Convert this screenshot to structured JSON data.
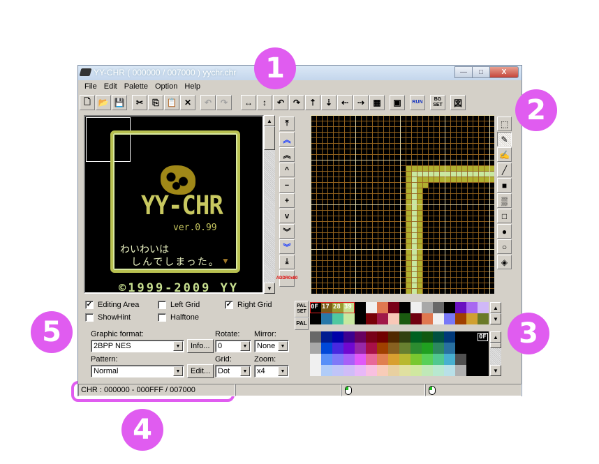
{
  "window": {
    "title": "YY-CHR ( 000000 / 007000 ) yychr.chr",
    "caption_buttons": {
      "minimize": "—",
      "maximize": "□",
      "close": "X"
    }
  },
  "menu": [
    "File",
    "Edit",
    "Palette",
    "Option",
    "Help"
  ],
  "toolbar": {
    "file_buttons": [
      {
        "name": "new-file-icon",
        "glyph": "🗋"
      },
      {
        "name": "open-folder-icon",
        "glyph": "📂"
      },
      {
        "name": "save-icon",
        "glyph": "💾"
      }
    ],
    "edit_buttons": [
      {
        "name": "cut-icon",
        "glyph": "✂"
      },
      {
        "name": "copy-icon",
        "glyph": "⎘"
      },
      {
        "name": "paste-icon",
        "glyph": "📋"
      },
      {
        "name": "delete-icon",
        "glyph": "✕"
      }
    ],
    "history_buttons": [
      {
        "name": "undo-icon",
        "glyph": "↶"
      },
      {
        "name": "redo-icon",
        "glyph": "↷"
      }
    ],
    "transform_buttons": [
      {
        "name": "flip-horizontal-icon",
        "glyph": "↔"
      },
      {
        "name": "flip-vertical-icon",
        "glyph": "↕"
      },
      {
        "name": "rotate-left-icon",
        "glyph": "↶"
      },
      {
        "name": "rotate-right-icon",
        "glyph": "↷"
      },
      {
        "name": "shift-up-icon",
        "glyph": "⇡"
      },
      {
        "name": "shift-down-icon",
        "glyph": "⇣"
      },
      {
        "name": "shift-left-icon",
        "glyph": "⇠"
      },
      {
        "name": "shift-right-icon",
        "glyph": "⇢"
      },
      {
        "name": "replace-color-icon",
        "glyph": "▦"
      }
    ],
    "extra_buttons": [
      {
        "name": "capture-icon",
        "glyph": "▣"
      },
      {
        "name": "run-icon",
        "label": "RUN"
      },
      {
        "name": "bg-set-icon",
        "label": "BG SET"
      },
      {
        "name": "kanji-icon",
        "glyph": "図"
      }
    ]
  },
  "preview": {
    "logo": "YY-CHR",
    "version": "ver.0.99",
    "message_line1": "わいわいは",
    "message_line2": "しんでしまった。",
    "copyright": "©1999-2009 YY"
  },
  "nav_buttons": [
    {
      "name": "scroll-top-icon",
      "glyph": "⤒"
    },
    {
      "name": "page-up-fast-icon",
      "glyph": "︽",
      "blue": true
    },
    {
      "name": "page-up-icon",
      "glyph": "︽"
    },
    {
      "name": "line-up-icon",
      "glyph": "^"
    },
    {
      "name": "minus-icon",
      "glyph": "−"
    },
    {
      "name": "plus-icon",
      "glyph": "+"
    },
    {
      "name": "line-down-icon",
      "glyph": "v"
    },
    {
      "name": "page-down-icon",
      "glyph": "︾"
    },
    {
      "name": "page-down-fast-icon",
      "glyph": "︾",
      "blue": true
    },
    {
      "name": "scroll-bottom-icon",
      "glyph": "⤓"
    }
  ],
  "addr_button": {
    "line1": "ADDR",
    "line2": "0x80"
  },
  "tools": [
    {
      "name": "select-tool-icon",
      "glyph": "⬚"
    },
    {
      "name": "pen-tool-icon",
      "glyph": "✎",
      "active": true
    },
    {
      "name": "brush-tool-icon",
      "glyph": "✍"
    },
    {
      "name": "line-tool-icon",
      "glyph": "╱"
    },
    {
      "name": "filled-rect-tool-icon",
      "glyph": "■"
    },
    {
      "name": "dither-rect-tool-icon",
      "glyph": "▒"
    },
    {
      "name": "rect-tool-icon",
      "glyph": "□"
    },
    {
      "name": "filled-circle-tool-icon",
      "glyph": "●"
    },
    {
      "name": "circle-tool-icon",
      "glyph": "○"
    },
    {
      "name": "fill-bucket-tool-icon",
      "glyph": "◈"
    }
  ],
  "checkboxes": [
    {
      "label": "Editing Area",
      "checked": true
    },
    {
      "label": "Left Grid",
      "checked": false
    },
    {
      "label": "Right Grid",
      "checked": true
    },
    {
      "label": "ShowHint",
      "checked": false
    },
    {
      "label": "Halftone",
      "checked": false
    }
  ],
  "settings": {
    "graphic_format_label": "Graphic format:",
    "graphic_format_value": "2BPP NES",
    "info_button": "Info...",
    "rotate_label": "Rotate:",
    "rotate_value": "0",
    "mirror_label": "Mirror:",
    "mirror_value": "None",
    "pattern_label": "Pattern:",
    "pattern_value": "Normal",
    "edit_button": "Edit...",
    "grid_label": "Grid:",
    "grid_value": "Dot",
    "zoom_label": "Zoom:",
    "zoom_value": "x4"
  },
  "palette": {
    "palset_tab": "PAL SET",
    "pal_tab": "PAL",
    "active_labels": [
      "0F",
      "17",
      "28",
      "39"
    ],
    "set_colors": [
      "#000000",
      "#7a5c18",
      "#9a9a30",
      "#c8e090",
      "#000000",
      "#f0f0f0",
      "#e07850",
      "#780018",
      "#000000",
      "#f0f0f0",
      "#a8a8a8",
      "#686868",
      "#000000",
      "#6a10c0",
      "#a868f0",
      "#d0b8f8",
      "#000000",
      "#2878a8",
      "#50c8a0",
      "#c8e8a0",
      "#000000",
      "#780008",
      "#a01848",
      "#f8c8b8",
      "#1a5a10",
      "#700010",
      "#e07850",
      "#f0f0f0",
      "#7878f8",
      "#a04000",
      "#d0a030",
      "#6a7a28"
    ],
    "selected_label": "0F",
    "grid_colors": [
      "#686868",
      "#001c90",
      "#0000a8",
      "#3c0090",
      "#680060",
      "#780018",
      "#700000",
      "#502800",
      "#304010",
      "#006020",
      "#105810",
      "#005040",
      "#003878",
      "#000000",
      "#000000",
      "#000000",
      "#a8a8a8",
      "#0048d8",
      "#4828e0",
      "#7008d0",
      "#9828a8",
      "#a81048",
      "#a04000",
      "#886020",
      "#688030",
      "#2c8c30",
      "#20a020",
      "#2c8860",
      "#2870a0",
      "#000000",
      "#000000",
      "#000000",
      "#f0f0f0",
      "#5890f8",
      "#8078f8",
      "#a860f8",
      "#e058f8",
      "#e86898",
      "#e08050",
      "#d8a030",
      "#b8b830",
      "#78c830",
      "#58d058",
      "#50c890",
      "#48b0d0",
      "#505050",
      "#000000",
      "#000000",
      "#f0f0f0",
      "#b0ccf8",
      "#c0c4f8",
      "#d0bcf8",
      "#e8b8f8",
      "#f8c0e0",
      "#f8ccb8",
      "#e8d0a0",
      "#e0e0a0",
      "#d0e8a0",
      "#c0e8b8",
      "#b8e8d0",
      "#b8e0e8",
      "#b0b0b0",
      "#000000",
      "#000000"
    ]
  },
  "status": {
    "chr_range": "CHR : 000000 - 000FFF / 007000"
  },
  "callouts": [
    "1",
    "2",
    "3",
    "4",
    "5"
  ],
  "colors": {
    "callout": "#e05cf0",
    "window_bg": "#d4d0c8"
  }
}
